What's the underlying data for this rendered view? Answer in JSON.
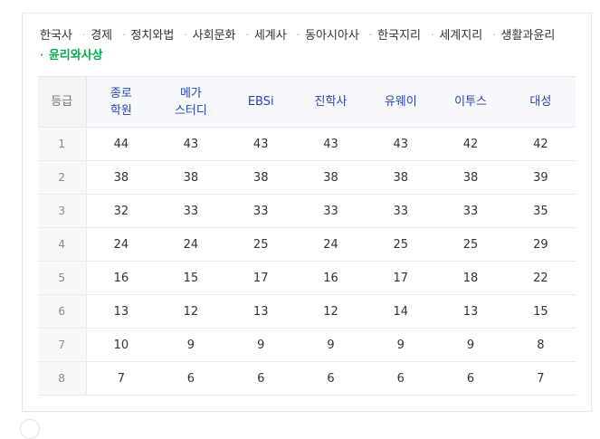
{
  "subjects": [
    "한국사",
    "경제",
    "정치와법",
    "사회문화",
    "세계사",
    "동아시아사",
    "한국지리",
    "세계지리",
    "생활과윤리",
    "윤리와사상"
  ],
  "active_subject": "윤리와사상",
  "table": {
    "grade_header": "등급",
    "columns": [
      {
        "line1": "종로",
        "line2": "학원"
      },
      {
        "line1": "메가",
        "line2": "스터디"
      },
      {
        "line1": "EBSi",
        "line2": ""
      },
      {
        "line1": "진학사",
        "line2": ""
      },
      {
        "line1": "유웨이",
        "line2": ""
      },
      {
        "line1": "이투스",
        "line2": ""
      },
      {
        "line1": "대성",
        "line2": ""
      }
    ],
    "rows": [
      {
        "grade": "1",
        "values": [
          "44",
          "43",
          "43",
          "43",
          "43",
          "42",
          "42"
        ]
      },
      {
        "grade": "2",
        "values": [
          "38",
          "38",
          "38",
          "38",
          "38",
          "38",
          "39"
        ]
      },
      {
        "grade": "3",
        "values": [
          "32",
          "33",
          "33",
          "33",
          "33",
          "33",
          "35"
        ]
      },
      {
        "grade": "4",
        "values": [
          "24",
          "24",
          "25",
          "24",
          "25",
          "25",
          "29"
        ]
      },
      {
        "grade": "5",
        "values": [
          "16",
          "15",
          "17",
          "16",
          "17",
          "18",
          "22"
        ]
      },
      {
        "grade": "6",
        "values": [
          "13",
          "12",
          "13",
          "12",
          "14",
          "13",
          "15"
        ]
      },
      {
        "grade": "7",
        "values": [
          "10",
          "9",
          "9",
          "9",
          "9",
          "9",
          "8"
        ]
      },
      {
        "grade": "8",
        "values": [
          "7",
          "6",
          "6",
          "6",
          "6",
          "6",
          "7"
        ]
      }
    ]
  }
}
